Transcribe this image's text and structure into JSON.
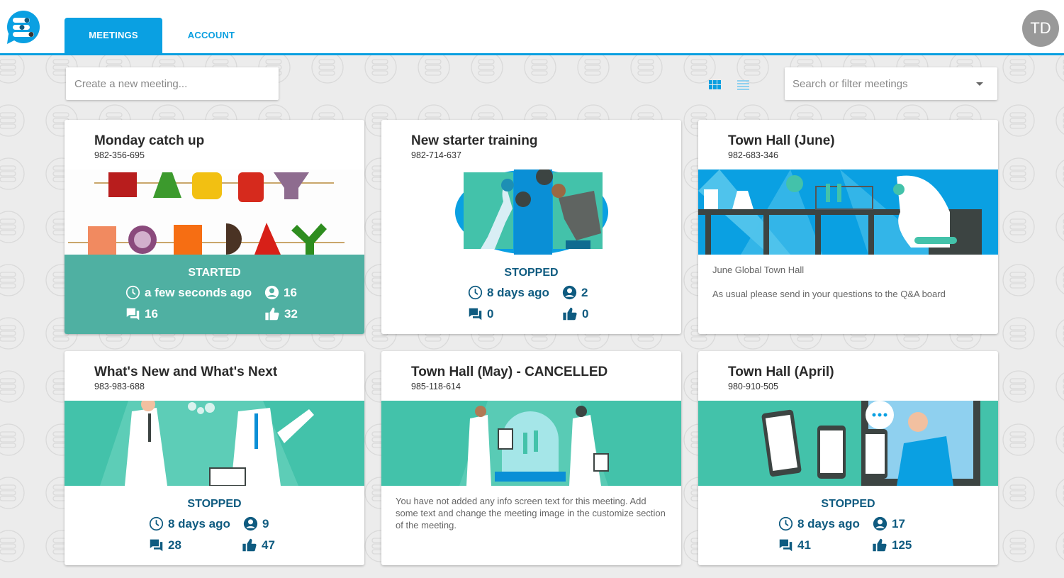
{
  "header": {
    "logo": "chat-logo-icon",
    "tabs": [
      {
        "label": "MEETINGS",
        "active": true
      },
      {
        "label": "ACCOUNT",
        "active": false
      }
    ],
    "avatar_initials": "TD"
  },
  "toolbar": {
    "create_placeholder": "Create a new meeting...",
    "view_grid_icon": "grid-view-icon",
    "view_list_icon": "list-view-icon",
    "search_placeholder": "Search or filter meetings"
  },
  "colors": {
    "brand_blue": "#0aa0e2",
    "started_teal": "#4fb0a2",
    "stopped_text": "#0f5b80",
    "background": "#ececec"
  },
  "meetings": [
    {
      "title": "Monday catch up",
      "code": "982-356-695",
      "image": "happy-monday-vegetables",
      "status": "STARTED",
      "time": "a few seconds ago",
      "participants": "16",
      "questions": "16",
      "likes": "32"
    },
    {
      "title": "New starter training",
      "code": "982-714-637",
      "image": "people-handshake-illustration",
      "status": "STOPPED",
      "time": "8 days ago",
      "participants": "2",
      "questions": "0",
      "likes": "0"
    },
    {
      "title": "Town Hall (June)",
      "code": "982-683-346",
      "image": "laboratory-illustration",
      "info_line1": "June Global Town Hall",
      "info_line2": "As usual please send in your questions to the Q&A board"
    },
    {
      "title": "What's New and What's Next",
      "code": "983-983-688",
      "image": "scientists-illustration",
      "status": "STOPPED",
      "time": "8 days ago",
      "participants": "9",
      "questions": "28",
      "likes": "47"
    },
    {
      "title": "Town Hall (May) - CANCELLED",
      "code": "985-118-614",
      "image": "lab-dome-illustration",
      "info_text": "You have not added any info screen text for this meeting. Add some text and change the meeting image in the customize section of the meeting."
    },
    {
      "title": "Town Hall (April)",
      "code": "980-910-505",
      "image": "phones-chat-illustration",
      "status": "STOPPED",
      "time": "8 days ago",
      "participants": "17",
      "questions": "41",
      "likes": "125"
    }
  ]
}
